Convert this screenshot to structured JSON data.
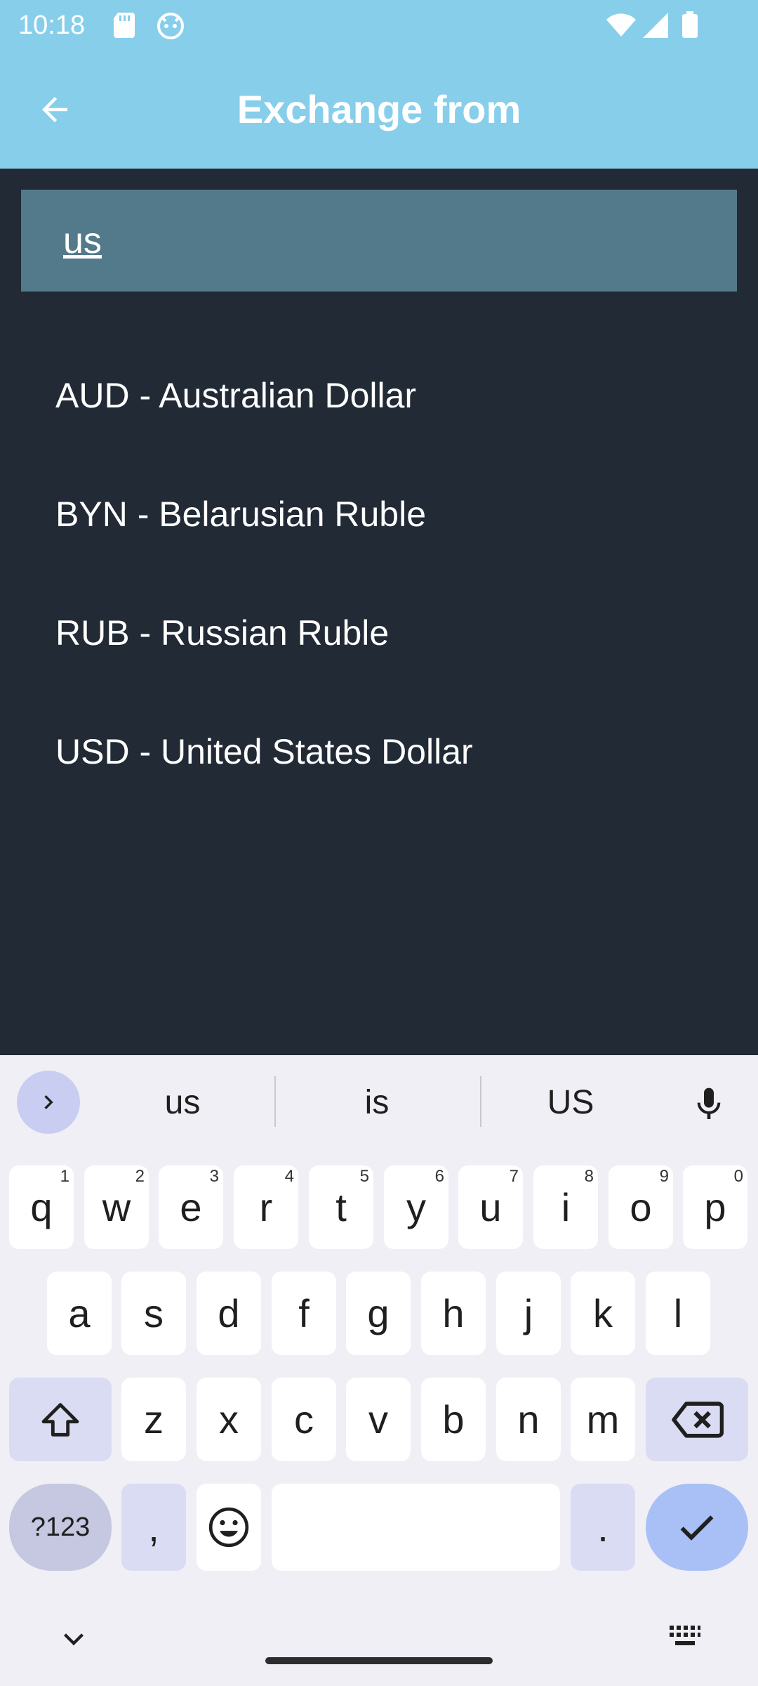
{
  "status_bar": {
    "time": "10:18"
  },
  "app_bar": {
    "title": "Exchange from"
  },
  "search": {
    "value": "us"
  },
  "currencies": [
    {
      "label": "AUD - Australian Dollar"
    },
    {
      "label": "BYN - Belarusian Ruble"
    },
    {
      "label": "RUB - Russian Ruble"
    },
    {
      "label": "USD - United States Dollar"
    }
  ],
  "keyboard": {
    "suggestions": [
      "us",
      "is",
      "US"
    ],
    "row1": [
      {
        "k": "q",
        "h": "1"
      },
      {
        "k": "w",
        "h": "2"
      },
      {
        "k": "e",
        "h": "3"
      },
      {
        "k": "r",
        "h": "4"
      },
      {
        "k": "t",
        "h": "5"
      },
      {
        "k": "y",
        "h": "6"
      },
      {
        "k": "u",
        "h": "7"
      },
      {
        "k": "i",
        "h": "8"
      },
      {
        "k": "o",
        "h": "9"
      },
      {
        "k": "p",
        "h": "0"
      }
    ],
    "row2": [
      "a",
      "s",
      "d",
      "f",
      "g",
      "h",
      "j",
      "k",
      "l"
    ],
    "row3": [
      "z",
      "x",
      "c",
      "v",
      "b",
      "n",
      "m"
    ],
    "symbols_label": "?123",
    "comma_label": ",",
    "period_label": "."
  },
  "colors": {
    "app_bar": "#87ceeb",
    "background": "#212a35",
    "search_box": "#537a8a",
    "keyboard_bg": "#f0eff6",
    "enter_key": "#a8c0f5"
  }
}
